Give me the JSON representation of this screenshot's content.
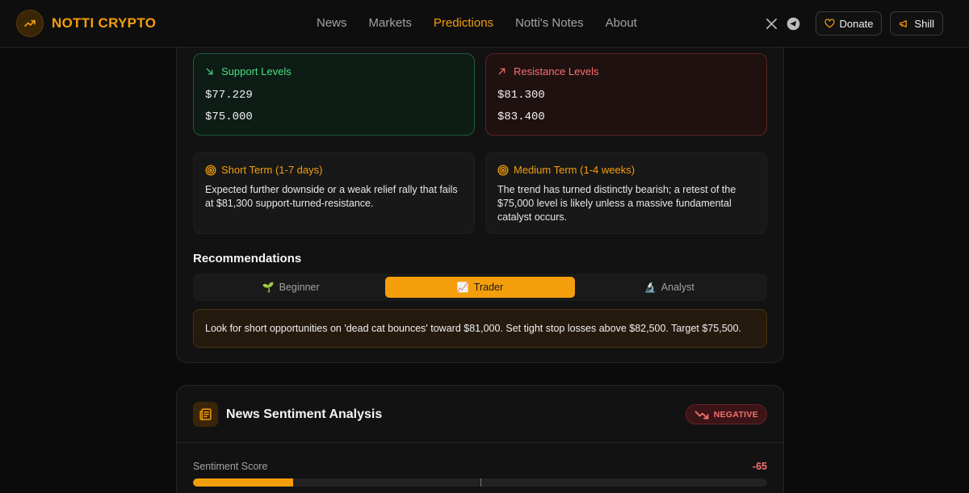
{
  "header": {
    "brand": "NOTTI CRYPTO",
    "logo_icon": "trending-up-icon",
    "nav": [
      "News",
      "Markets",
      "Predictions",
      "Notti's Notes",
      "About"
    ],
    "active_nav": "Predictions",
    "social": [
      "x-icon",
      "telegram-icon"
    ],
    "donate_label": "Donate",
    "shill_label": "Shill"
  },
  "levels": {
    "support_title": "Support Levels",
    "support": [
      "$77.229",
      "$75.000"
    ],
    "resistance_title": "Resistance Levels",
    "resistance": [
      "$81.300",
      "$83.400"
    ]
  },
  "terms": {
    "short_title": "Short Term (1-7 days)",
    "short_text": "Expected further downside or a weak relief rally that fails at $81,300 support-turned-resistance.",
    "medium_title": "Medium Term (1-4 weeks)",
    "medium_text": "The trend has turned distinctly bearish; a retest of the $75,000 level is likely unless a massive fundamental catalyst occurs."
  },
  "recommendations": {
    "heading": "Recommendations",
    "tabs": [
      {
        "emoji": "🌱",
        "label": "Beginner"
      },
      {
        "emoji": "📈",
        "label": "Trader"
      },
      {
        "emoji": "🔬",
        "label": "Analyst"
      }
    ],
    "active_tab": "Trader",
    "text": "Look for short opportunities on 'dead cat bounces' toward $81,000. Set tight stop losses above $82,500. Target $75,500."
  },
  "sentiment": {
    "title": "News Sentiment Analysis",
    "badge": "NEGATIVE",
    "score_label": "Sentiment Score",
    "score": "-65",
    "bar_fill_fraction": 0.175
  },
  "colors": {
    "accent": "#f59e0b",
    "positive": "#4ade80",
    "negative": "#f87171"
  }
}
